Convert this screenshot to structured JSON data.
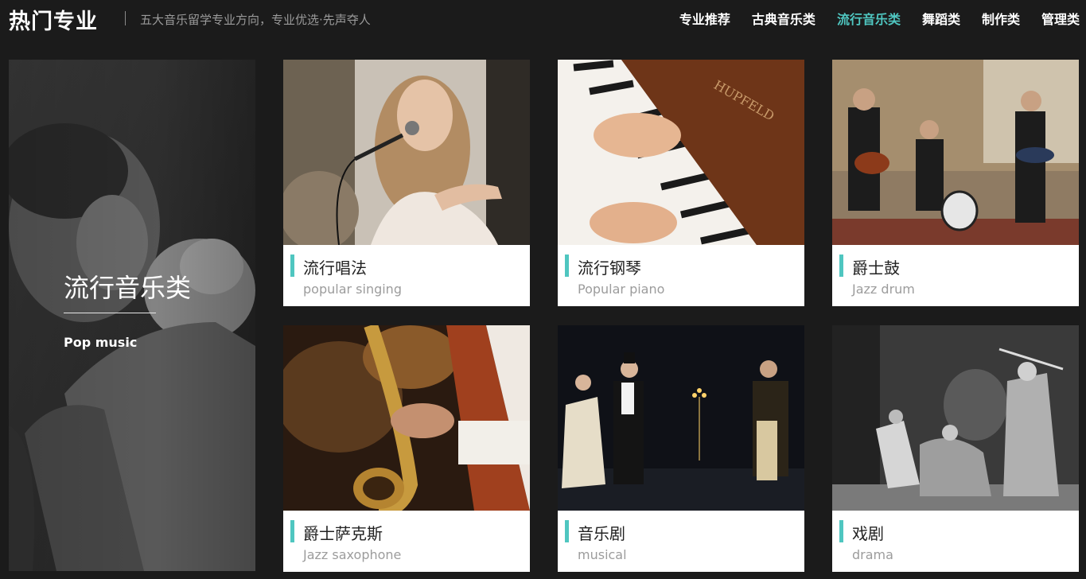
{
  "header": {
    "brand": "热门专业",
    "tagline": "五大音乐留学专业方向，专业优选·先声夺人",
    "nav": [
      {
        "label": "专业推荐",
        "active": false
      },
      {
        "label": "古典音乐类",
        "active": false
      },
      {
        "label": "流行音乐类",
        "active": true
      },
      {
        "label": "舞蹈类",
        "active": false
      },
      {
        "label": "制作类",
        "active": false
      },
      {
        "label": "管理类",
        "active": false
      }
    ]
  },
  "feature": {
    "title": "流行音乐类",
    "subtitle": "Pop music"
  },
  "cards": [
    {
      "title": "流行唱法",
      "subtitle": "popular singing",
      "image": "singer-photo"
    },
    {
      "title": "流行钢琴",
      "subtitle": "Popular piano",
      "image": "piano-photo"
    },
    {
      "title": "爵士鼓",
      "subtitle": "Jazz drum",
      "image": "jazz-band-photo"
    },
    {
      "title": "爵士萨克斯",
      "subtitle": "Jazz saxophone",
      "image": "saxophone-photo"
    },
    {
      "title": "音乐剧",
      "subtitle": "musical",
      "image": "musical-stage-photo"
    },
    {
      "title": "戏剧",
      "subtitle": "drama",
      "image": "drama-stage-photo"
    }
  ],
  "colors": {
    "accent": "#4fc6c0",
    "background": "#1b1b1b",
    "card": "#ffffff"
  }
}
